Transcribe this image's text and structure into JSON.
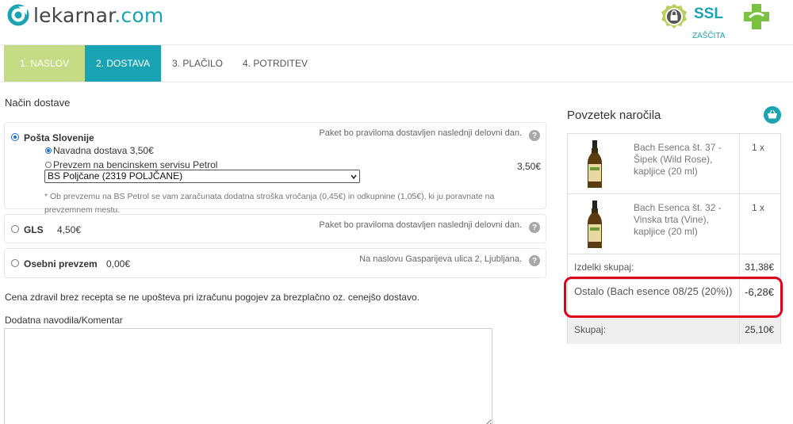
{
  "brand": {
    "name_main": "lekarnar",
    "name_tld": ".com",
    "accent_color": "#1aa3b3"
  },
  "ssl": {
    "title": "SSL",
    "subtitle": "ZAŠČITA",
    "icon": "lock-badge-icon"
  },
  "pharmacy_icon": "green-cross-icon",
  "steps": [
    {
      "label": "1.   NASLOV",
      "state": "done",
      "color": "#c5dc84"
    },
    {
      "label": "2. DOSTAVA",
      "state": "active",
      "color": "#1aa3b3"
    },
    {
      "label": "3. PLAČILO",
      "state": "pending"
    },
    {
      "label": "4. POTRDITEV",
      "state": "pending"
    }
  ],
  "delivery": {
    "title": "Način dostave",
    "options": [
      {
        "name": "Pošta Slovenije",
        "selected": true,
        "note": "Paket bo praviloma dostavljen naslednji delovni dan.",
        "sub_options": [
          {
            "label": "Navadna dostava 3,50€",
            "selected": true
          },
          {
            "label": "Prevzem na bencinskem servisu Petrol",
            "selected": false,
            "price": "3,50€"
          }
        ],
        "station_select": "BS Poljčane (2319 POLJČANE)",
        "fine_print": "* Ob prevzemu na BS Petrol se vam zaračunata dodatna stroška vročanja (0,45€) in odkupnine (1,05€), ki ju poravnate na prevzemnem mestu."
      },
      {
        "name": "GLS",
        "price": "4,50€",
        "selected": false,
        "note": "Paket bo praviloma dostavljen naslednji delovni dan."
      },
      {
        "name": "Osebni prevzem",
        "price": "0,00€",
        "selected": false,
        "note": "Na naslovu Gasparijeva ulica 2, Ljubljana."
      }
    ],
    "free_shipping_note": "Cena zdravil brez recepta se ne upošteva pri izračunu pogojev za brezplačno oz. cenejšo dostavo.",
    "comment_label": "Dodatna navodila/Komentar",
    "comment_value": ""
  },
  "summary": {
    "title": "Povzetek naročila",
    "items": [
      {
        "name": "Bach Esenca št. 37 - Šipek (Wild Rose), kapljice (20 ml)",
        "qty": "1 x"
      },
      {
        "name": "Bach Esenca št. 32 - Vinska trta (Vine), kapljice (20 ml)",
        "qty": "1 x"
      }
    ],
    "subtotal_label": "Izdelki skupaj:",
    "subtotal_value": "31,38€",
    "discount_label": "Ostalo (Bach esence 08/25 (20%))",
    "discount_value": "-6,28€",
    "total_label": "Skupaj:",
    "total_value": "25,10€",
    "highlight_color": "#e0001b"
  }
}
